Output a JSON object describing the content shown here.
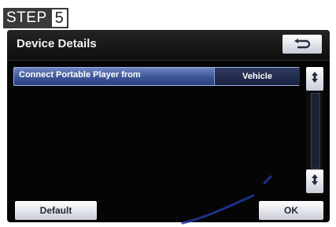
{
  "step": {
    "label": "STEP",
    "number": "5"
  },
  "screen": {
    "title": "Device Details",
    "back_icon": "return-arrow-icon",
    "setting": {
      "label": "Connect Portable Player from",
      "value": "Vehicle"
    },
    "scroll": {
      "up_icon": "scroll-up-icon",
      "down_icon": "scroll-down-icon"
    },
    "buttons": {
      "default_label": "Default",
      "ok_label": "OK"
    }
  }
}
